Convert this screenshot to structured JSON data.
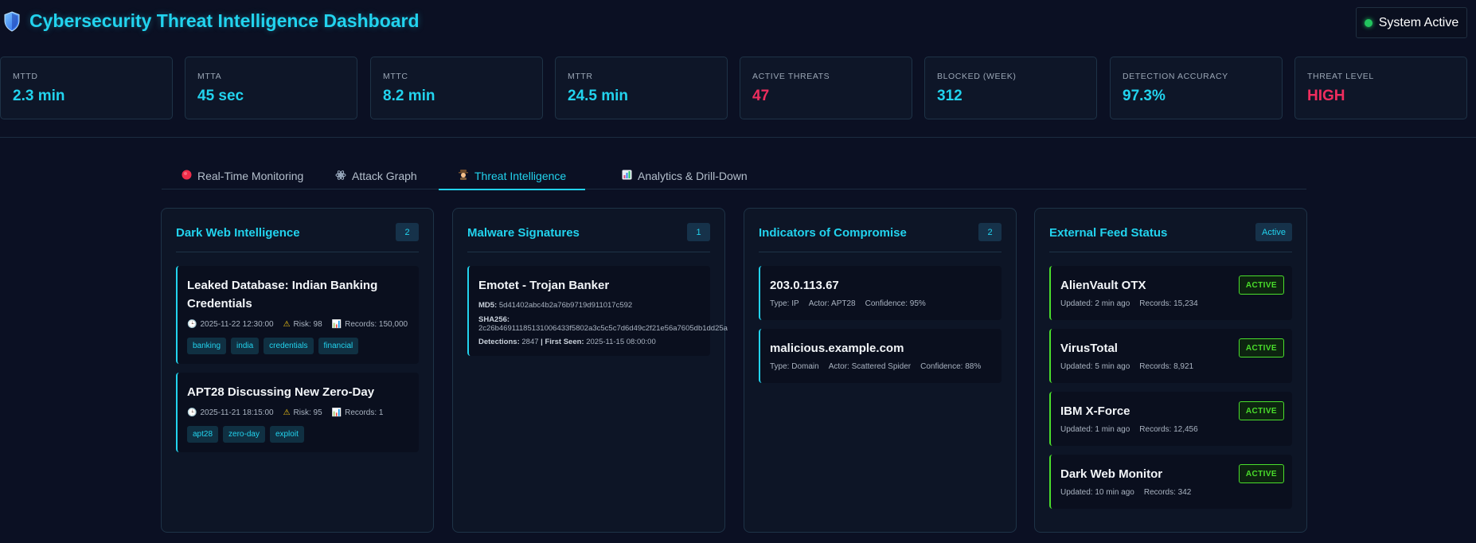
{
  "header": {
    "title": "Cybersecurity Threat Intelligence Dashboard",
    "system_status": "System Active",
    "status_color": "#22c55e",
    "brand_color": "#22d3ee"
  },
  "metrics": [
    {
      "label": "MTTD",
      "value": "2.3 min"
    },
    {
      "label": "MTTA",
      "value": "45 sec"
    },
    {
      "label": "MTTC",
      "value": "8.2 min"
    },
    {
      "label": "MTTR",
      "value": "24.5 min"
    },
    {
      "label": "ACTIVE THREATS",
      "value": "47"
    },
    {
      "label": "BLOCKED (WEEK)",
      "value": "312"
    },
    {
      "label": "DETECTION ACCURACY",
      "value": "97.3%"
    },
    {
      "label": "THREAT LEVEL",
      "value": "HIGH"
    }
  ],
  "tabs": [
    {
      "label": "Real-Time Monitoring",
      "icon": "red-circle-icon"
    },
    {
      "label": "Attack Graph",
      "icon": "atom-icon"
    },
    {
      "label": "Threat Intelligence",
      "icon": "detective-icon",
      "active": true
    },
    {
      "label": "Analytics & Drill-Down",
      "icon": "bar-chart-icon"
    }
  ],
  "dark_web": {
    "title": "Dark Web Intelligence",
    "count": "2",
    "items": [
      {
        "title": "Leaked Database: Indian Banking Credentials",
        "date": "2025-11-22 12:30:00",
        "risk": "Risk: 98",
        "records": "Records: 150,000",
        "tags": [
          "banking",
          "india",
          "credentials",
          "financial"
        ]
      },
      {
        "title": "APT28 Discussing New Zero-Day",
        "date": "2025-11-21 18:15:00",
        "risk": "Risk: 95",
        "records": "Records: 1",
        "tags": [
          "apt28",
          "zero-day",
          "exploit"
        ]
      }
    ]
  },
  "malware": {
    "title": "Malware Signatures",
    "count": "1",
    "items": [
      {
        "title": "Emotet - Trojan Banker",
        "md5_label": "MD5:",
        "md5": "5d41402abc4b2a76b9719d911017c592",
        "sha_label": "SHA256:",
        "sha256": "2c26b46911185131006433f5802a3c5c5c7d6d49c2f21e56a7605db1dd25a",
        "detections_label": "Detections:",
        "detections": "2847",
        "separator": "|",
        "first_seen_label": "First Seen:",
        "first_seen": "2025-11-15 08:00:00"
      }
    ]
  },
  "ioc": {
    "title": "Indicators of Compromise",
    "count": "2",
    "items": [
      {
        "title": "203.0.113.67",
        "type": "Type: IP",
        "actor": "Actor: APT28",
        "confidence": "Confidence: 95%"
      },
      {
        "title": "malicious.example.com",
        "type": "Type: Domain",
        "actor": "Actor: Scattered Spider",
        "confidence": "Confidence: 88%"
      }
    ]
  },
  "feeds": {
    "title": "External Feed Status",
    "badge": "Active",
    "items": [
      {
        "name": "AlienVault OTX",
        "updated": "Updated: 2 min ago",
        "records": "Records: 15,234",
        "status": "ACTIVE"
      },
      {
        "name": "VirusTotal",
        "updated": "Updated: 5 min ago",
        "records": "Records: 8,921",
        "status": "ACTIVE"
      },
      {
        "name": "IBM X-Force",
        "updated": "Updated: 1 min ago",
        "records": "Records: 12,456",
        "status": "ACTIVE"
      },
      {
        "name": "Dark Web Monitor",
        "updated": "Updated: 10 min ago",
        "records": "Records: 342",
        "status": "ACTIVE"
      }
    ]
  }
}
